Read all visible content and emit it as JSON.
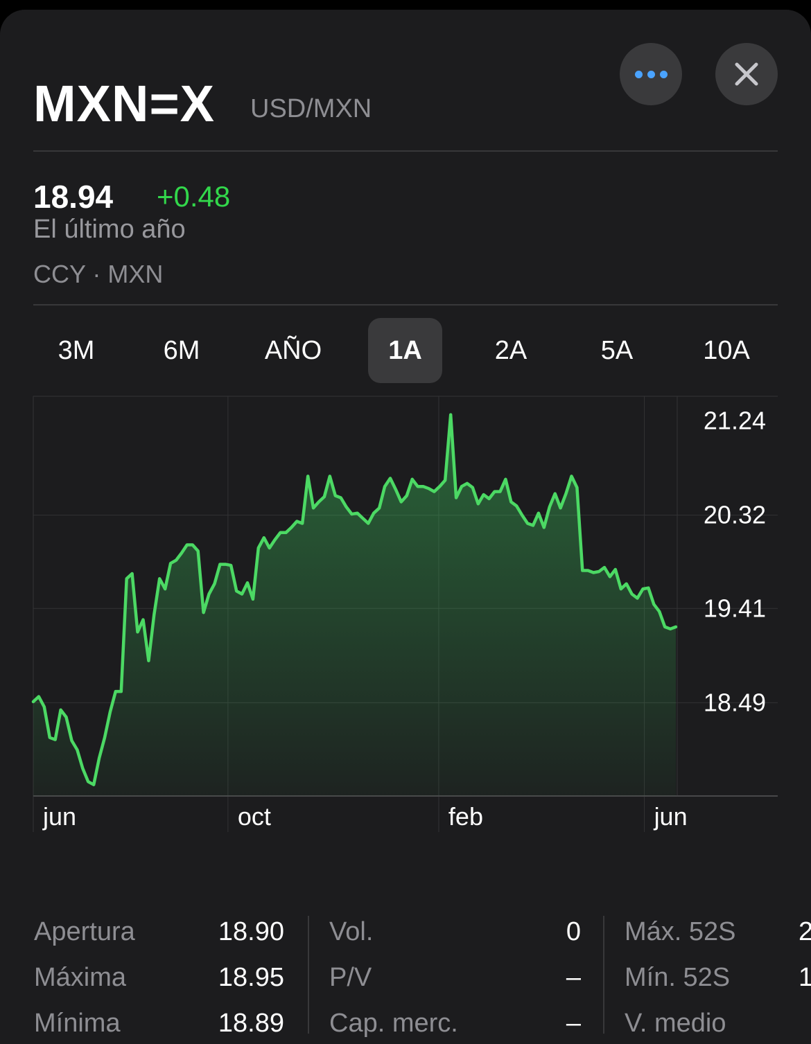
{
  "header": {
    "symbol": "MXN=X",
    "pair": "USD/MXN",
    "more_icon": "ellipsis-icon",
    "close_icon": "close-icon",
    "accent_color": "#4aa3ff"
  },
  "quote": {
    "price": "18.94",
    "change": "+0.48",
    "change_color": "#32d74b",
    "period_label": "El último año",
    "exchange": "CCY · MXN"
  },
  "tabs": [
    {
      "label": "3M"
    },
    {
      "label": "6M"
    },
    {
      "label": "AÑO"
    },
    {
      "label": "1A",
      "selected": true
    },
    {
      "label": "2A"
    },
    {
      "label": "5A"
    },
    {
      "label": "10A"
    }
  ],
  "chart_data": {
    "type": "area",
    "line_color": "#4cd964",
    "y_ticks": [
      "21.24",
      "20.32",
      "19.41",
      "18.49"
    ],
    "y_tick_values": [
      21.24,
      20.32,
      19.41,
      18.49
    ],
    "ylim": [
      17.58,
      21.48
    ],
    "x_tick_labels": [
      "jun",
      "oct",
      "feb",
      "jun"
    ],
    "x_tick_positions": [
      0,
      0.303,
      0.631,
      0.951
    ],
    "grid": true,
    "values": [
      18.5,
      18.55,
      18.45,
      18.15,
      18.13,
      18.42,
      18.35,
      18.12,
      18.03,
      17.85,
      17.72,
      17.69,
      17.95,
      18.15,
      18.4,
      18.6,
      18.6,
      19.7,
      19.75,
      19.18,
      19.3,
      18.9,
      19.35,
      19.7,
      19.6,
      19.85,
      19.88,
      19.95,
      20.03,
      20.03,
      19.97,
      19.37,
      19.55,
      19.65,
      19.84,
      19.84,
      19.83,
      19.58,
      19.55,
      19.66,
      19.5,
      20.0,
      20.1,
      20.0,
      20.08,
      20.15,
      20.15,
      20.2,
      20.26,
      20.24,
      20.7,
      20.39,
      20.45,
      20.5,
      20.7,
      20.51,
      20.49,
      20.4,
      20.33,
      20.34,
      20.29,
      20.24,
      20.34,
      20.39,
      20.6,
      20.68,
      20.57,
      20.45,
      20.51,
      20.67,
      20.6,
      20.6,
      20.58,
      20.55,
      20.6,
      20.66,
      21.3,
      20.49,
      20.6,
      20.63,
      20.59,
      20.43,
      20.52,
      20.48,
      20.55,
      20.55,
      20.67,
      20.45,
      20.41,
      20.32,
      20.24,
      20.22,
      20.34,
      20.2,
      20.4,
      20.53,
      20.39,
      20.53,
      20.7,
      20.59,
      19.78,
      19.78,
      19.76,
      19.77,
      19.81,
      19.72,
      19.79,
      19.6,
      19.65,
      19.55,
      19.51,
      19.6,
      19.61,
      19.45,
      19.38,
      19.23,
      19.21,
      19.23
    ]
  },
  "stats": {
    "col1": [
      {
        "label": "Apertura",
        "value": "18.90"
      },
      {
        "label": "Máxima",
        "value": "18.95"
      },
      {
        "label": "Mínima",
        "value": "18.89"
      }
    ],
    "col2": [
      {
        "label": "Vol.",
        "value": "0"
      },
      {
        "label": "P/V",
        "value": "–"
      },
      {
        "label": "Cap. merc.",
        "value": "–"
      }
    ],
    "col3": [
      {
        "label": "Máx. 52S",
        "value": "2"
      },
      {
        "label": "Mín. 52S",
        "value": "1"
      },
      {
        "label": "V. medio",
        "value": ""
      }
    ]
  }
}
